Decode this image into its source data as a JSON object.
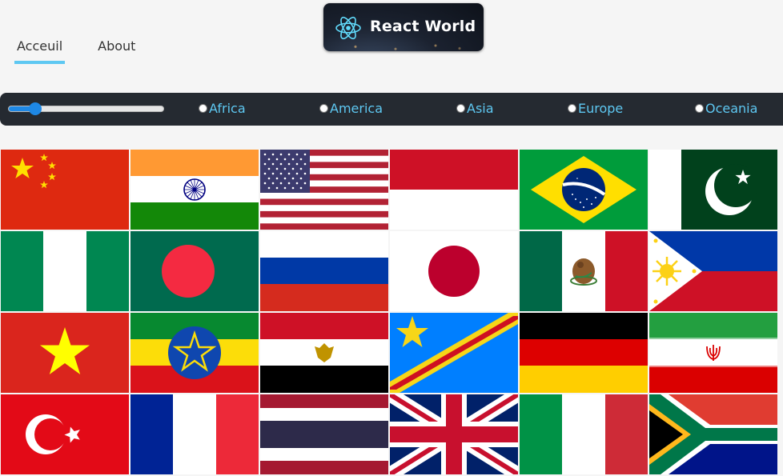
{
  "nav": {
    "items": [
      {
        "label": "Acceuil",
        "active": true
      },
      {
        "label": "About",
        "active": false
      }
    ]
  },
  "logo": {
    "text": "React World",
    "icon": "react-atom-icon",
    "accent": "#61dafb"
  },
  "filter": {
    "population_slider_value": 0.17,
    "regions": [
      "Africa",
      "America",
      "Asia",
      "Europe",
      "Oceania"
    ],
    "colors": {
      "bar": "#252a31",
      "label": "#5ec8f2",
      "slider": "#1e88e5"
    }
  },
  "flags": [
    {
      "country": "China"
    },
    {
      "country": "India"
    },
    {
      "country": "United States"
    },
    {
      "country": "Indonesia"
    },
    {
      "country": "Brazil"
    },
    {
      "country": "Pakistan"
    },
    {
      "country": "Nigeria"
    },
    {
      "country": "Bangladesh"
    },
    {
      "country": "Russia"
    },
    {
      "country": "Japan"
    },
    {
      "country": "Mexico"
    },
    {
      "country": "Philippines"
    },
    {
      "country": "Vietnam"
    },
    {
      "country": "Ethiopia"
    },
    {
      "country": "Egypt"
    },
    {
      "country": "DR Congo"
    },
    {
      "country": "Germany"
    },
    {
      "country": "Iran"
    },
    {
      "country": "Turkey"
    },
    {
      "country": "France"
    },
    {
      "country": "Thailand"
    },
    {
      "country": "United Kingdom"
    },
    {
      "country": "Italy"
    },
    {
      "country": "South Africa"
    }
  ]
}
